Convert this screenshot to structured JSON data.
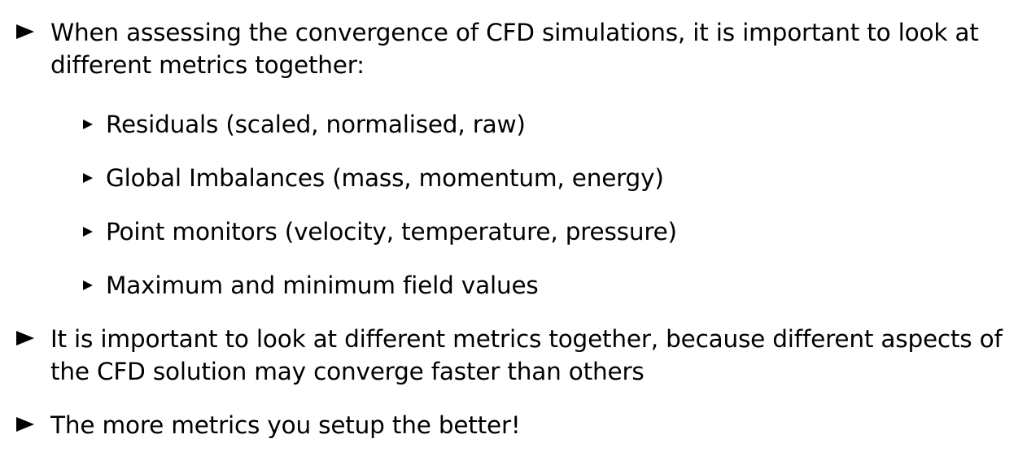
{
  "bullets": [
    {
      "text": "When assessing the convergence of CFD simulations, it is important to look at different metrics together:",
      "sub_bullets": [
        {
          "text": "Residuals (scaled, normalised, raw)"
        },
        {
          "text": "Global Imbalances (mass, momentum, energy)"
        },
        {
          "text": "Point monitors (velocity, temperature, pressure)"
        },
        {
          "text": "Maximum and minimum field values"
        }
      ]
    },
    {
      "text": "It is important to look at different metrics together, because different aspects of the CFD solution may converge faster than others"
    },
    {
      "text": "The more metrics you setup the better!"
    }
  ]
}
